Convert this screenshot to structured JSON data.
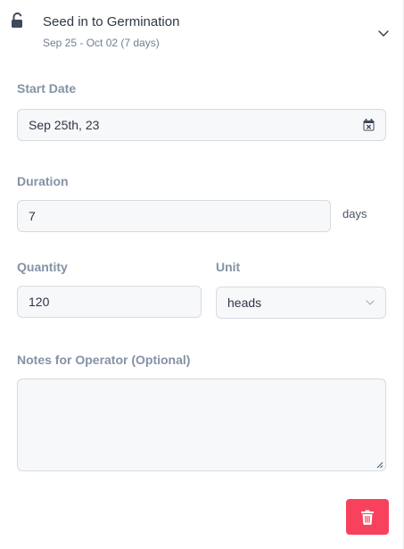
{
  "step": {
    "title": "Seed in to Germination",
    "subtitle": "Sep 25 - Oct 02 (7 days)",
    "lock_icon": "lock-open-icon",
    "toggle_icon": "chevron-down-icon"
  },
  "form": {
    "start_date": {
      "label": "Start Date",
      "value": "Sep 25th, 23",
      "icon": "calendar-icon"
    },
    "duration": {
      "label": "Duration",
      "value": "7",
      "suffix": "days"
    },
    "quantity": {
      "label": "Quantity",
      "value": "120"
    },
    "unit": {
      "label": "Unit",
      "value": "heads"
    },
    "notes": {
      "label": "Notes for Operator (Optional)",
      "value": ""
    }
  },
  "actions": {
    "delete_icon": "trash-icon"
  },
  "colors": {
    "danger": "#f7415d",
    "label": "#8492a6",
    "border": "#d6dbe1",
    "field_bg": "#f7f8fa"
  }
}
